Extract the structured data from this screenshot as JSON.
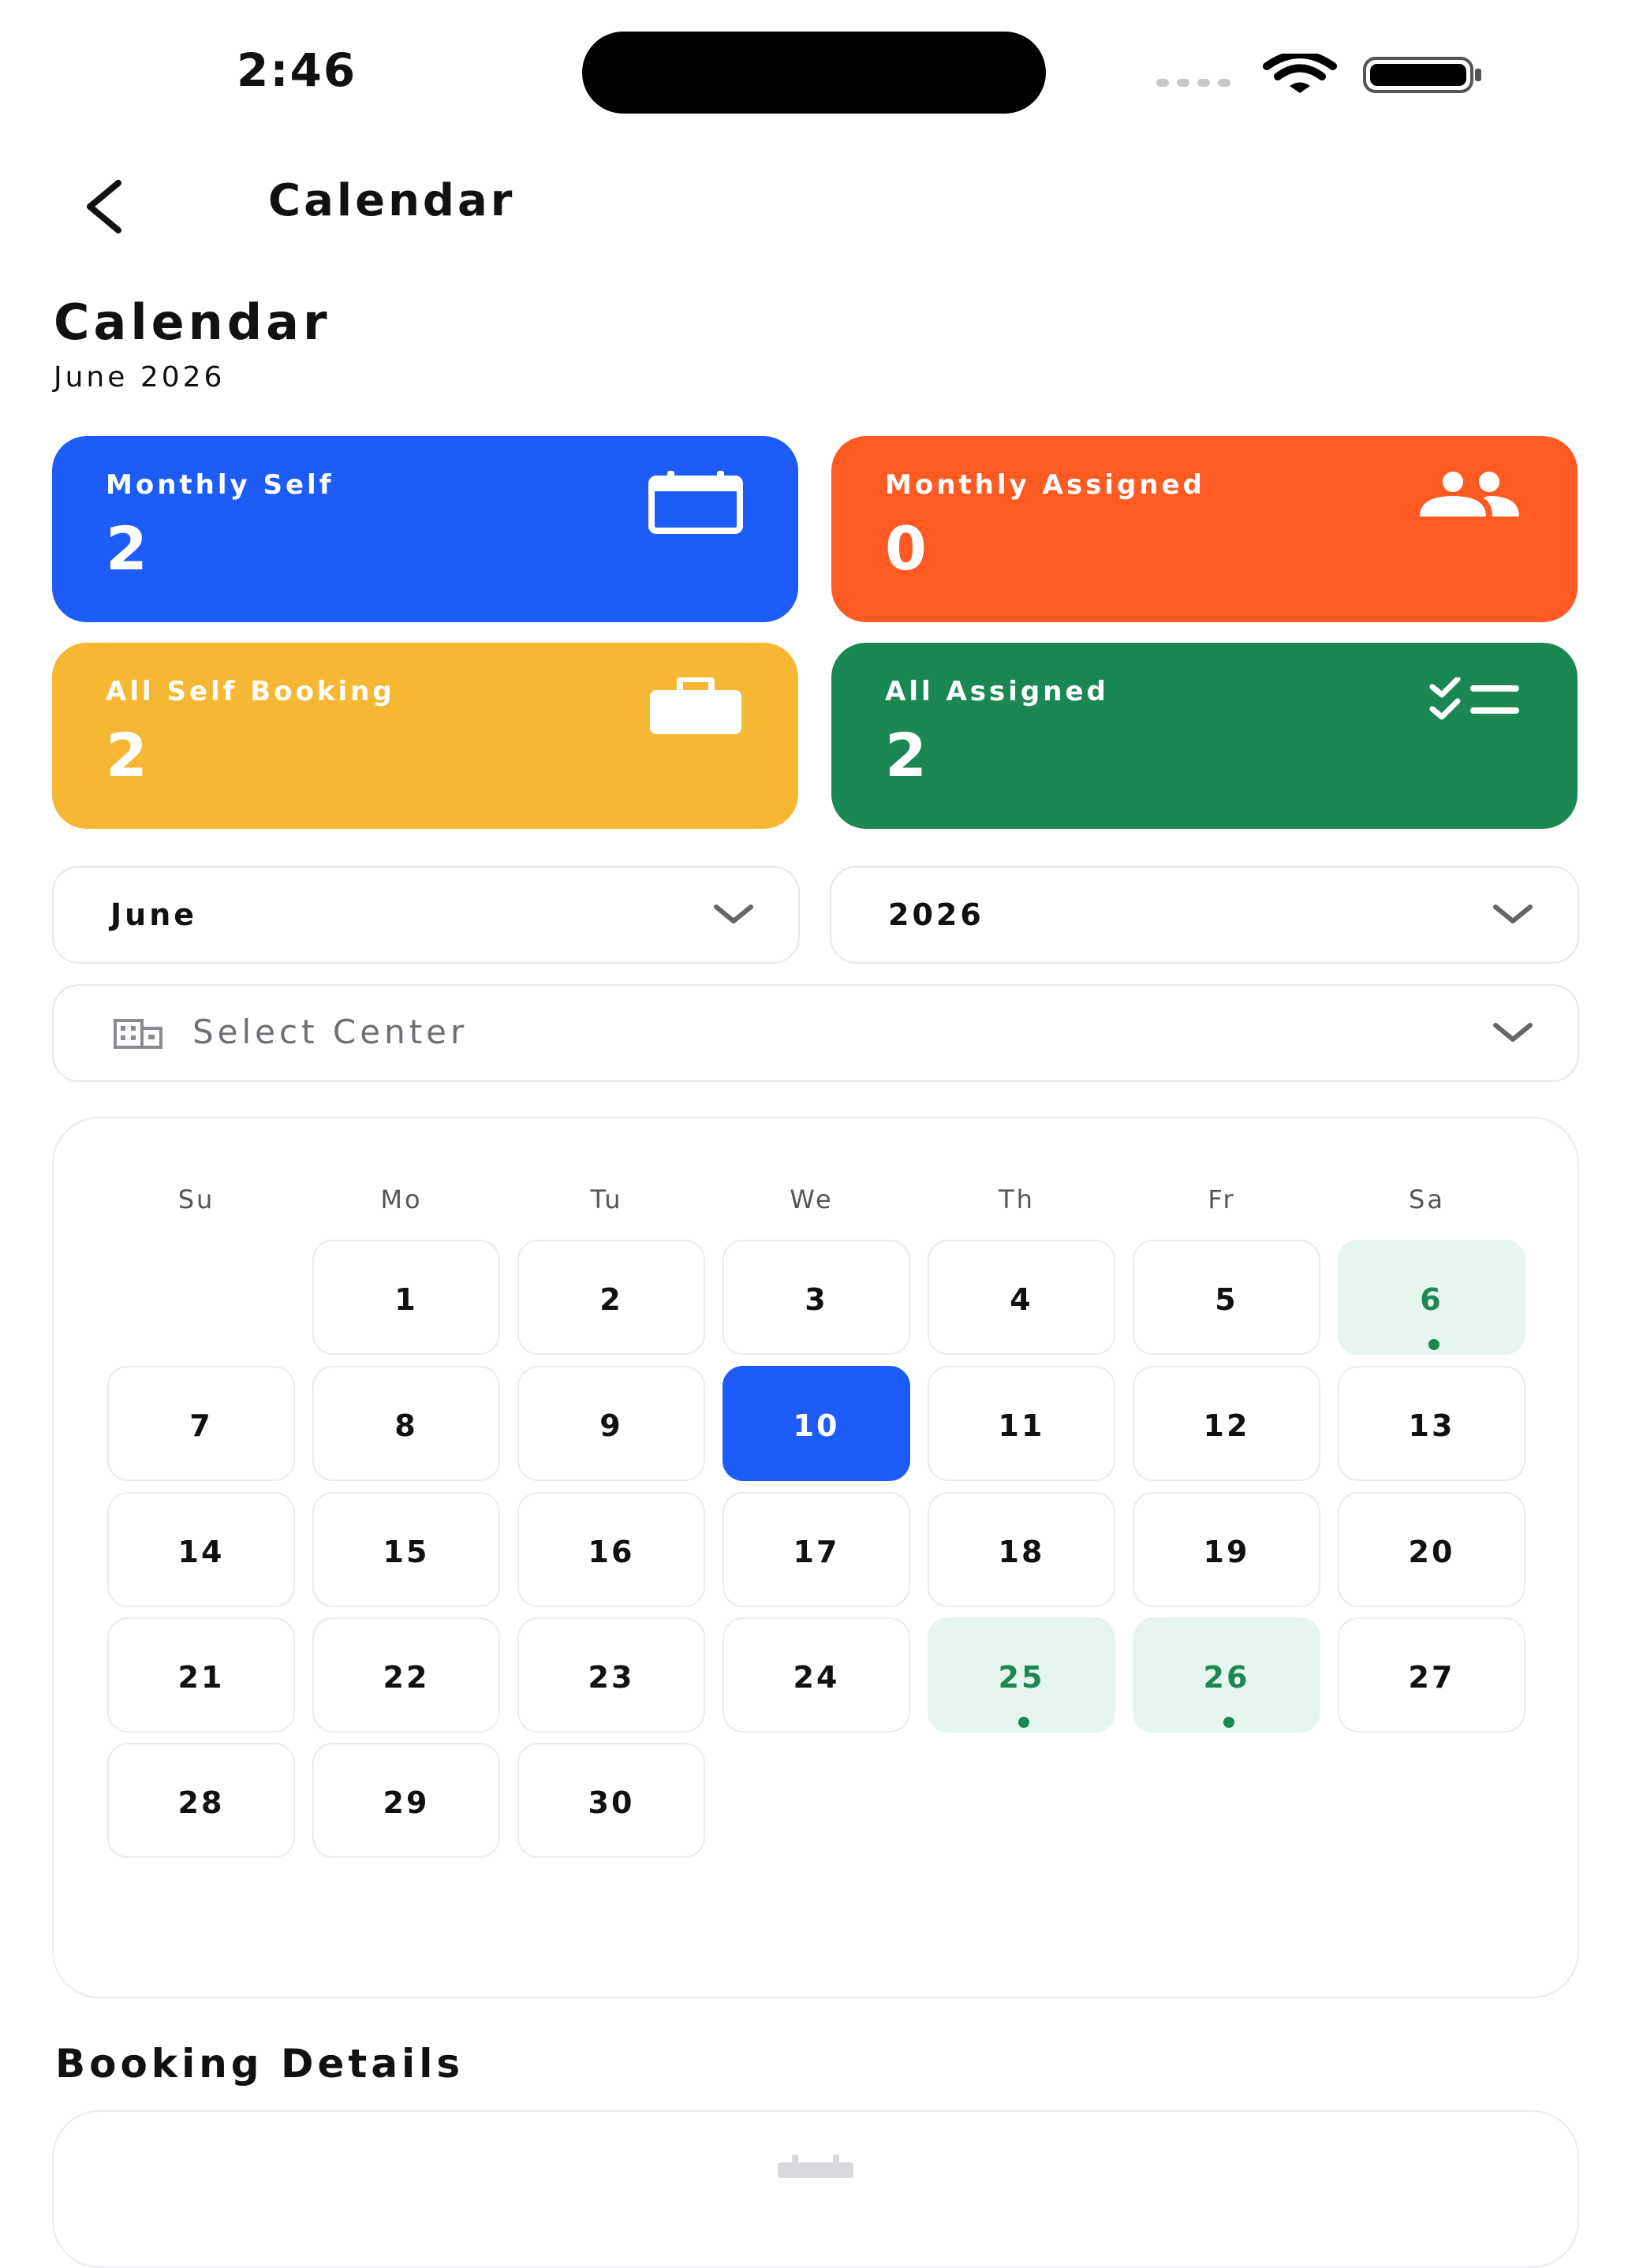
{
  "status_bar": {
    "time": "2:46"
  },
  "nav": {
    "title": "Calendar",
    "back_icon": "chevron-left-icon"
  },
  "header": {
    "title": "Calendar",
    "subtitle": "June 2026"
  },
  "stats": [
    {
      "label": "Monthly Self",
      "value": "2",
      "icon": "calendar-icon",
      "color": "#1d5cf6"
    },
    {
      "label": "Monthly Assigned",
      "value": "0",
      "icon": "people-icon",
      "color": "#ff5a22"
    },
    {
      "label": "All Self Booking",
      "value": "2",
      "icon": "briefcase-icon",
      "color": "#f6b733"
    },
    {
      "label": "All Assigned",
      "value": "2",
      "icon": "checklist-icon",
      "color": "#1b8854"
    }
  ],
  "filters": {
    "month": "June",
    "year": "2026",
    "center_placeholder": "Select Center"
  },
  "calendar": {
    "weekdays": [
      "Su",
      "Mo",
      "Tu",
      "We",
      "Th",
      "Fr",
      "Sa"
    ],
    "days": [
      "1",
      "2",
      "3",
      "4",
      "5",
      "6",
      "7",
      "8",
      "9",
      "10",
      "11",
      "12",
      "13",
      "14",
      "15",
      "16",
      "17",
      "18",
      "19",
      "20",
      "21",
      "22",
      "23",
      "24",
      "25",
      "26",
      "27",
      "28",
      "29",
      "30"
    ],
    "selected_day": "10",
    "event_days": [
      "6",
      "25",
      "26"
    ],
    "accent_color": "#1d5cf6",
    "event_color": "#1b8854"
  },
  "booking": {
    "title": "Booking Details"
  }
}
